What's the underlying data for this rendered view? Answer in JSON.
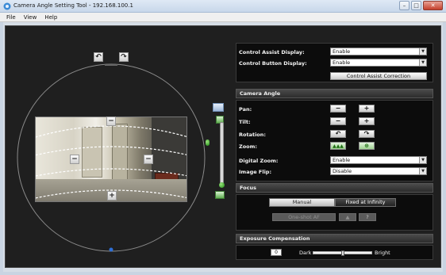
{
  "window": {
    "title": "Camera Angle Setting Tool - 192.168.100.1",
    "minimize_glyph": "–",
    "maximize_glyph": "□",
    "close_glyph": "✕"
  },
  "menu": [
    "File",
    "View",
    "Help"
  ],
  "camera_view": {
    "minus_glyph": "−",
    "plus_glyph": "+",
    "rotate_left_glyph": "↶",
    "rotate_right_glyph": "↷"
  },
  "control_display": {
    "assist_label": "Control Assist Display:",
    "assist_value": "Enable",
    "button_label": "Control Button Display:",
    "button_value": "Enable",
    "correction_button": "Control Assist Correction"
  },
  "camera_angle": {
    "header": "Camera Angle",
    "pan_label": "Pan:",
    "tilt_label": "Tilt:",
    "rotation_label": "Rotation:",
    "zoom_label": "Zoom:",
    "digital_zoom_label": "Digital Zoom:",
    "digital_zoom_value": "Enable",
    "image_flip_label": "Image Flip:",
    "image_flip_value": "Disable"
  },
  "focus": {
    "header": "Focus",
    "manual": "Manual",
    "fixed": "Fixed at Infinity",
    "one_shot": "One-shot AF",
    "help_glyph": "?"
  },
  "exposure": {
    "header": "Exposure Compensation",
    "value": "0",
    "dark_label": "Dark",
    "bright_label": "Bright",
    "level": 0.5
  },
  "icons": {
    "app": "camera-app-icon",
    "dropdown": "chevron-down-icon"
  },
  "colors": {
    "panel_bg": "#0c0c0c",
    "workarea_bg": "#1f1f1f",
    "accent_green": "#1c8a12"
  }
}
